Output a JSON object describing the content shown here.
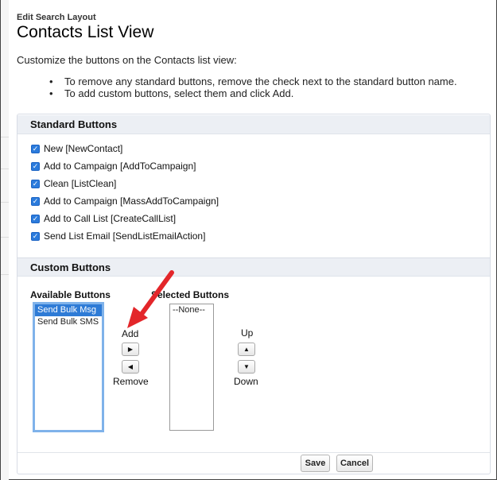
{
  "header": {
    "subtitle": "Edit Search Layout",
    "title": "Contacts List View"
  },
  "intro": {
    "description": "Customize the buttons on the Contacts list view:",
    "bullets": [
      "To remove any standard buttons, remove the check next to the standard button name.",
      "To add custom buttons, select them and click Add."
    ]
  },
  "standard_buttons": {
    "heading": "Standard Buttons",
    "items": [
      {
        "label": "New [NewContact]",
        "checked": true
      },
      {
        "label": "Add to Campaign [AddToCampaign]",
        "checked": true
      },
      {
        "label": "Clean [ListClean]",
        "checked": true
      },
      {
        "label": "Add to Campaign [MassAddToCampaign]",
        "checked": true
      },
      {
        "label": "Add to Call List [CreateCallList]",
        "checked": true
      },
      {
        "label": "Send List Email [SendListEmailAction]",
        "checked": true
      }
    ]
  },
  "custom_buttons": {
    "heading": "Custom Buttons",
    "available_label": "Available Buttons",
    "selected_label": "Selected Buttons",
    "available_options": [
      "Send Bulk Msg",
      "Send Bulk SMS"
    ],
    "selected_options": [
      "--None--"
    ],
    "add_label": "Add",
    "remove_label": "Remove",
    "up_label": "Up",
    "down_label": "Down"
  },
  "footer": {
    "save_label": "Save",
    "cancel_label": "Cancel"
  },
  "colors": {
    "checkbox": "#2b7bdc",
    "selection": "#2e7bd6",
    "annotation_arrow": "#e3262a"
  }
}
